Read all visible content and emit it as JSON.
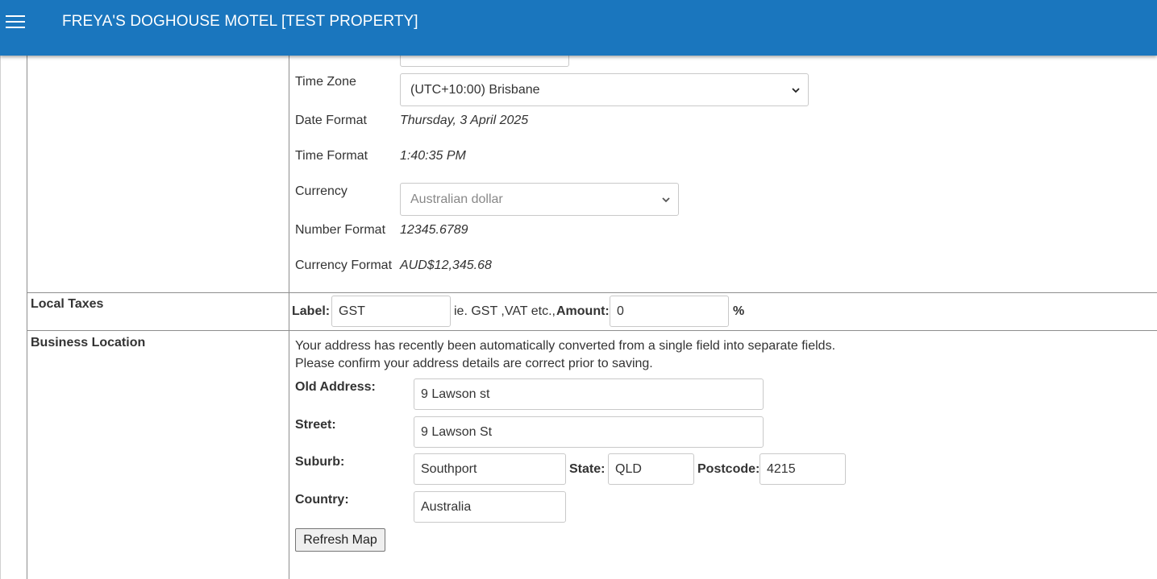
{
  "header": {
    "title": "FREYA'S DOGHOUSE MOTEL [TEST PROPERTY]",
    "menu_icon": "hamburger-menu-icon",
    "bg_color": "#1a76be"
  },
  "regional": {
    "timezone_label": "Time Zone",
    "timezone_value": "(UTC+10:00) Brisbane",
    "date_format_label": "Date Format",
    "date_format_value": "Thursday, 3 April 2025",
    "time_format_label": "Time Format",
    "time_format_value": "1:40:35 PM",
    "currency_label": "Currency",
    "currency_value": "Australian dollar",
    "number_format_label": "Number Format",
    "number_format_value": "12345.6789",
    "currency_format_label": "Currency Format",
    "currency_format_value": "AUD$12,345.68"
  },
  "local_taxes": {
    "section_label": "Local Taxes",
    "label_label": "Label:",
    "label_value": "GST",
    "hint": "ie. GST ,VAT etc.,",
    "amount_label": "Amount:",
    "amount_value": "0",
    "percent": "%"
  },
  "business_location": {
    "section_label": "Business Location",
    "notice_line1": "Your address has recently been automatically converted from a single field into separate fields.",
    "notice_line2": "Please confirm your address details are correct prior to saving.",
    "old_address_label": "Old Address:",
    "old_address_value": "9 Lawson st",
    "street_label": "Street:",
    "street_value": "9 Lawson St",
    "suburb_label": "Suburb:",
    "suburb_value": "Southport",
    "state_label": "State:",
    "state_value": "QLD",
    "postcode_label": "Postcode:",
    "postcode_value": "4215",
    "country_label": "Country:",
    "country_value": "Australia",
    "refresh_button": "Refresh Map"
  }
}
